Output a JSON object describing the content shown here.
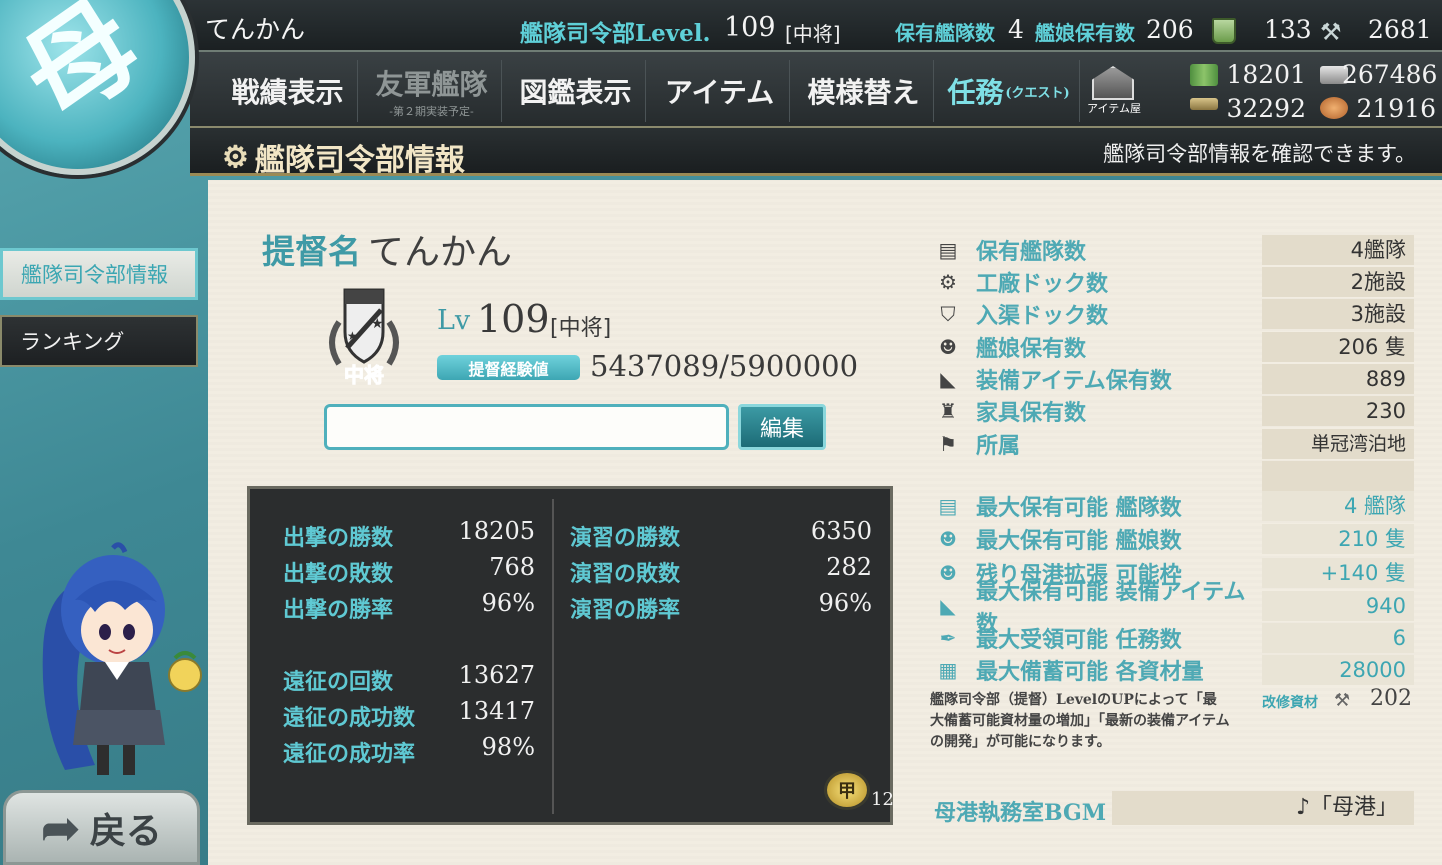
{
  "top": {
    "player_name": "てんかん",
    "hq_label": "艦隊司令部Level.",
    "hq_level": "109",
    "rank": "[中将]",
    "fleets_label": "保有艦隊数",
    "fleets": "4",
    "ships_label": "艦娘保有数",
    "ships": "206",
    "buckets": "133",
    "devmats": "2681"
  },
  "menu": {
    "battle_record": "戦績表示",
    "allied_fleet": "友軍艦隊",
    "allied_sub": "-第２期実装予定-",
    "library": "図鑑表示",
    "items": "アイテム",
    "furniture": "模様替え",
    "quest": "任務",
    "quest_sub": "(クエスト)",
    "item_shop": "アイテム屋"
  },
  "resources": {
    "fuel": "18201",
    "steel": "267486",
    "ammo": "32292",
    "bauxite": "21916"
  },
  "subheader": {
    "title": "艦隊司令部情報",
    "description": "艦隊司令部情報を確認できます。"
  },
  "sidebar": {
    "items": [
      {
        "label": "艦隊司令部情報"
      },
      {
        "label": "ランキング"
      }
    ],
    "back": "戻る"
  },
  "profile": {
    "admiral_label": "提督名",
    "admiral_name": "てんかん",
    "lv_label": "Lv",
    "level": "109",
    "rank": "[中将]",
    "badge_text": "中将",
    "exp_label": "提督経験値",
    "exp": "5437089/5900000",
    "comment_value": "",
    "edit_button": "編集"
  },
  "stats": {
    "sortie_wins_label": "出撃の勝数",
    "sortie_wins": "18205",
    "sortie_losses_label": "出撃の敗数",
    "sortie_losses": "768",
    "sortie_rate_label": "出撃の勝率",
    "sortie_rate": "96%",
    "exped_count_label": "遠征の回数",
    "exped_count": "13627",
    "exped_success_label": "遠征の成功数",
    "exped_success": "13417",
    "exped_rate_label": "遠征の成功率",
    "exped_rate": "98%",
    "pvp_wins_label": "演習の勝数",
    "pvp_wins": "6350",
    "pvp_losses_label": "演習の敗数",
    "pvp_losses": "282",
    "pvp_rate_label": "演習の勝率",
    "pvp_rate": "96%",
    "medal_glyph": "甲",
    "medals": "12"
  },
  "info": {
    "rows": [
      {
        "icon": "fleet-icon",
        "label": "保有艦隊数",
        "value": "4艦隊"
      },
      {
        "icon": "gear-icon",
        "label": "工廠ドック数",
        "value": "2施設"
      },
      {
        "icon": "shield-icon",
        "label": "入渠ドック数",
        "value": "3施設"
      },
      {
        "icon": "shipgirl-icon",
        "label": "艦娘保有数",
        "value": "206 隻"
      },
      {
        "icon": "equipment-icon",
        "label": "装備アイテム保有数",
        "value": "889"
      },
      {
        "icon": "chair-icon",
        "label": "家具保有数",
        "value": "230"
      },
      {
        "icon": "flag-icon",
        "label": "所属",
        "value": "単冠湾泊地"
      }
    ],
    "caps": [
      {
        "icon": "fleet-icon",
        "label": "最大保有可能 艦隊数",
        "value": "4 艦隊"
      },
      {
        "icon": "shipgirl-icon",
        "label": "最大保有可能 艦娘数",
        "value": "210 隻"
      },
      {
        "icon": "shipgirl-icon",
        "label": "残り母港拡張 可能枠",
        "value": "+140 隻"
      },
      {
        "icon": "equipment-icon",
        "label": "最大保有可能 装備アイテム数",
        "value": "940"
      },
      {
        "icon": "pen-icon",
        "label": "最大受領可能 任務数",
        "value": "6"
      },
      {
        "icon": "box-icon",
        "label": "最大備蓄可能 各資材量",
        "value": "28000"
      }
    ],
    "note": "艦隊司令部（提督）LevelのUPによって「最大備蓄可能資材量の増加」「最新の装備アイテムの開発」が可能になります。",
    "improvement_label": "改修資材",
    "improvement": "202",
    "bgm_label": "母港執務室BGM",
    "bgm_value": "♪「母港」"
  },
  "colors": {
    "accent": "#4ea9b4",
    "dark_bar": "#262b2d",
    "panel": "#f2ede2"
  }
}
